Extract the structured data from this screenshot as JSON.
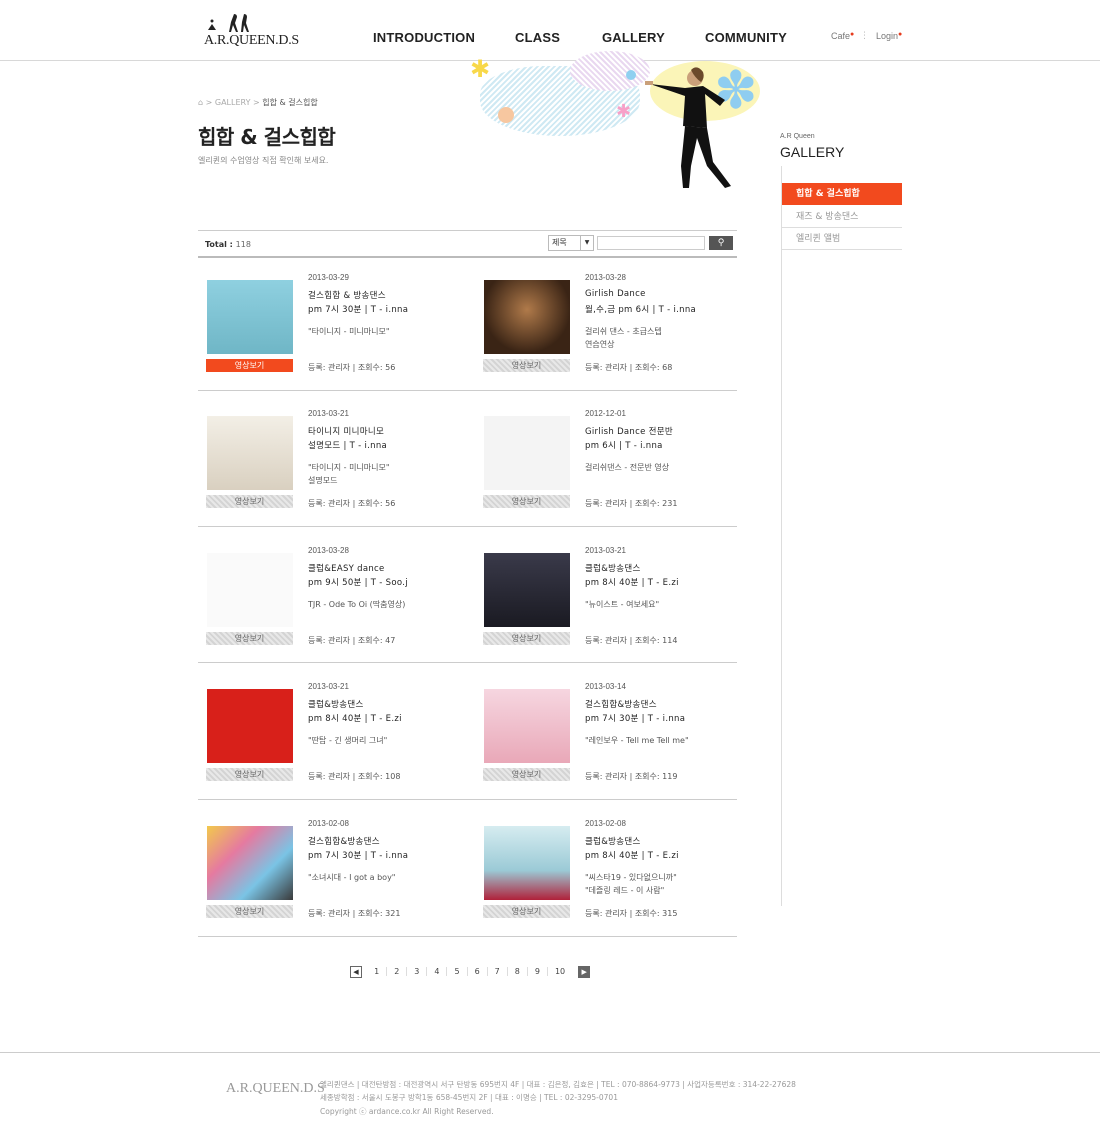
{
  "header": {
    "logo_text": "A.R.QUEEN.D.S",
    "nav": [
      "INTRODUCTION",
      "CLASS",
      "GALLERY",
      "COMMUNITY"
    ],
    "util": {
      "cafe": "Cafe",
      "login": "Login"
    }
  },
  "breadcrumb": {
    "section": "GALLERY",
    "current": "힙합 & 걸스힙합",
    "sep": ">"
  },
  "page": {
    "title": "힙합 & 걸스힙합",
    "desc": "엘리퀸의 수업영상 직접 확인해 보세요."
  },
  "sidebar": {
    "sub": "A.R Queen",
    "title": "GALLERY",
    "items": [
      "힙합 & 걸스힙합",
      "재즈 & 방송댄스",
      "엘리퀸 앨범"
    ]
  },
  "list": {
    "total_label": "Total :",
    "total": "118",
    "search_option": "제목",
    "view_label": "영상보기",
    "items": [
      {
        "date": "2013-03-29",
        "t1": "걸스힙합 & 방송댄스",
        "t2": "pm 7시 30분  |  T - i.nna",
        "desc1": "\"타이니지 - 미니마니모\"",
        "desc2": "",
        "meta": "등록: 관리자  |  조회수: 56"
      },
      {
        "date": "2013-03-28",
        "t1": "Girlish Dance",
        "t2": "월,수,금 pm 6시  |  T - i.nna",
        "desc1": "걸리쉬 댄스 - 초급스텝",
        "desc2": "연습연상",
        "meta": "등록: 관리자  |  조회수: 68"
      },
      {
        "date": "2013-03-21",
        "t1": "타이니지 미니마니모",
        "t2": "설명모드  |  T - i.nna",
        "desc1": "\"타이니지 - 미니마니모\"",
        "desc2": "설명모드",
        "meta": "등록: 관리자  |  조회수: 56"
      },
      {
        "date": "2012-12-01",
        "t1": "Girlish Dance 전문반",
        "t2": "pm 6시  |  T - i.nna",
        "desc1": "걸리쉬댄스 - 전문반 영상",
        "desc2": "",
        "meta": "등록: 관리자  |  조회수: 231"
      },
      {
        "date": "2013-03-28",
        "t1": "클럽&EASY dance",
        "t2": "pm 9시 50분  |  T - Soo.j",
        "desc1": "TJR - Ode To Oi (딱춤영상)",
        "desc2": "",
        "meta": "등록: 관리자  |  조회수: 47"
      },
      {
        "date": "2013-03-21",
        "t1": "클럽&방송댄스",
        "t2": "pm 8시 40분  |  T - E.zi",
        "desc1": "\"뉴이스트 - 여보세요\"",
        "desc2": "",
        "meta": "등록: 관리자  |  조회수: 114"
      },
      {
        "date": "2013-03-21",
        "t1": "클럽&방송댄스",
        "t2": "pm 8시 40분  |  T - E.zi",
        "desc1": "\"딴탑 - 긴 생머리 그녀\"",
        "desc2": "",
        "meta": "등록: 관리자  |  조회수: 108"
      },
      {
        "date": "2013-03-14",
        "t1": "걸스힙합&방송댄스",
        "t2": "pm 7시 30분  |  T - i.nna",
        "desc1": "\"레인보우 - Tell me Tell me\"",
        "desc2": "",
        "meta": "등록: 관리자  |  조회수: 119"
      },
      {
        "date": "2013-02-08",
        "t1": "걸스힙합&방송댄스",
        "t2": "pm 7시 30분  |  T - i.nna",
        "desc1": "\"소녀시대 - I got a boy\"",
        "desc2": "",
        "meta": "등록: 관리자  |  조회수: 321"
      },
      {
        "date": "2013-02-08",
        "t1": "클럽&방송댄스",
        "t2": "pm 8시 40분  |  T - E.zi",
        "desc1": "\"씨스타19 - 있다없으니까\"",
        "desc2": "\"데즐링 레드 - 이 사람\"",
        "meta": "등록: 관리자  |  조회수: 315"
      }
    ]
  },
  "pager": [
    "1",
    "2",
    "3",
    "4",
    "5",
    "6",
    "7",
    "8",
    "9",
    "10"
  ],
  "footer": {
    "logo": "A.R.QUEEN.D.S",
    "line1": "엘리퀸댄스  |  대전탄방점 : 대전광역시 서구 탄방동 695번지 4F  |  대표 : 김은정, 김효은  |  TEL : 070-8864-9773  |  사업자등록번호 : 314-22-27628",
    "line2": "세종방학점 : 서울시 도봉구 방학1동 658-45번지 2F  |  대표 : 이명승  |  TEL : 02-3295-0701",
    "line3": "Copyright ⓒ ardance.co.kr  All Right Reserved."
  },
  "colors": {
    "accent": "#f24a1e",
    "text": "#222222",
    "border": "#cccccc"
  }
}
